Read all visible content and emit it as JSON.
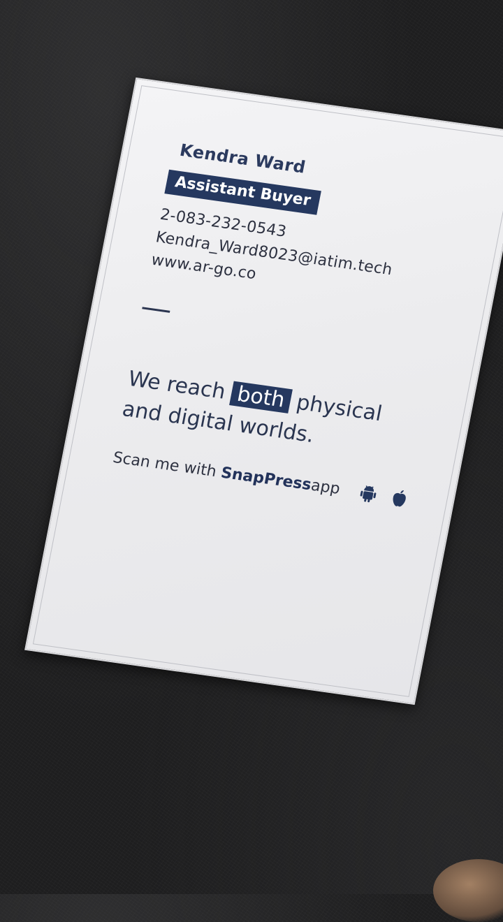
{
  "card": {
    "name": "Kendra Ward",
    "role": "Assistant Buyer",
    "phone": "2-083-232-0543",
    "email": "Kendra_Ward8023@iatim.tech",
    "website": "www.ar-go.co",
    "tagline": {
      "before": "We reach",
      "highlight": "both",
      "after_line1": "physical",
      "line2": "and digital worlds."
    },
    "scan": {
      "prefix": "Scan me with",
      "app": "SnapPress",
      "suffix": "app"
    },
    "icons": [
      "android-icon",
      "apple-icon"
    ],
    "colors": {
      "accent": "#25385f",
      "text": "#2d3140",
      "card": "#efeff1",
      "background": "#1e1e1f"
    }
  }
}
